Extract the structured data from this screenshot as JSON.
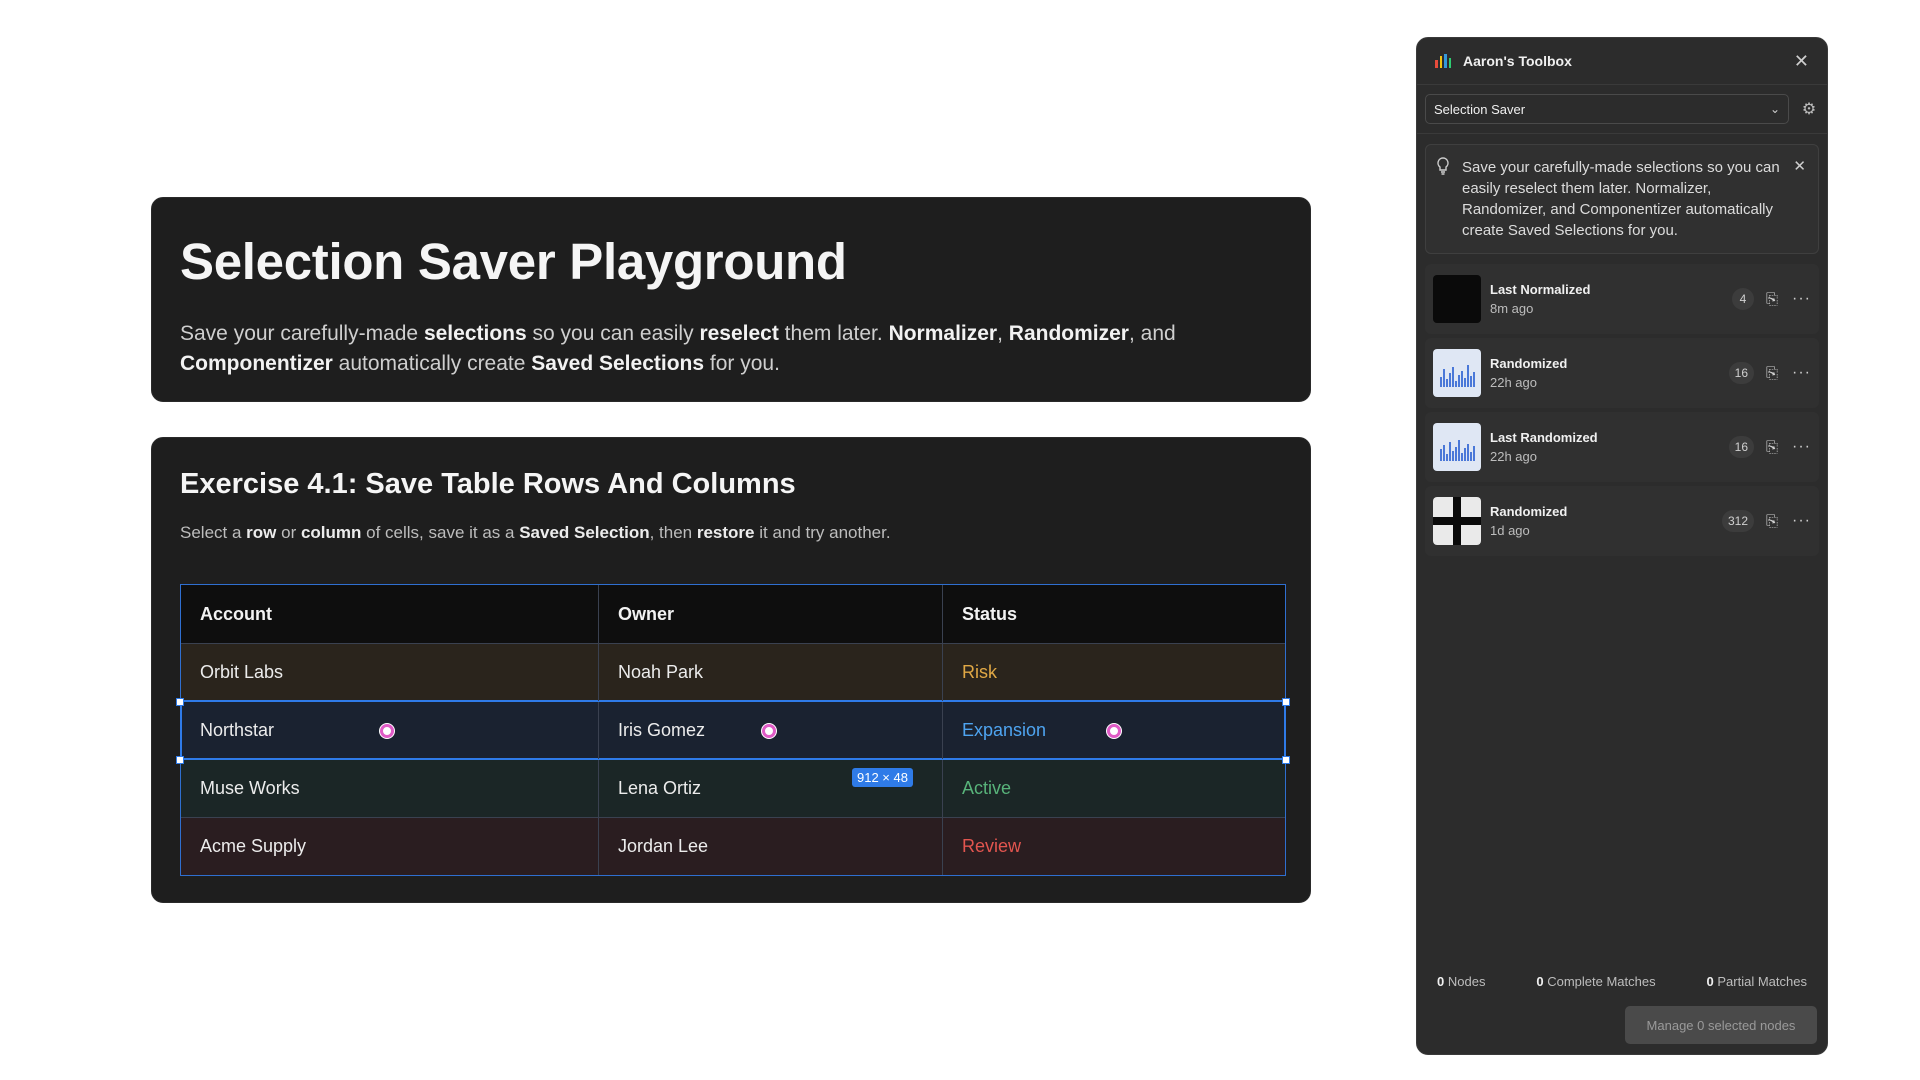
{
  "hero": {
    "title": "Selection Saver Playground",
    "desc_parts": [
      "Save your carefully-made ",
      "selections",
      " so you can easily ",
      "reselect",
      " them later. ",
      "Normalizer",
      ", ",
      "Randomizer",
      ", and ",
      "Componentizer",
      " automatically create ",
      "Saved Selections",
      " for you."
    ]
  },
  "exercise": {
    "title": "Exercise 4.1: Save Table Rows And Columns",
    "desc_parts": [
      "Select a ",
      "row",
      " or ",
      "column",
      " of cells, save it as a ",
      "Saved Selection",
      ", then ",
      "restore",
      " it and try another."
    ],
    "table": {
      "headers": [
        "Account",
        "Owner",
        "Status"
      ],
      "rows": [
        [
          "Orbit Labs",
          "Noah Park",
          "Risk"
        ],
        [
          "Northstar",
          "Iris Gomez",
          "Expansion"
        ],
        [
          "Muse Works",
          "Lena Ortiz",
          "Active"
        ],
        [
          "Acme Supply",
          "Jordan Lee",
          "Review"
        ]
      ],
      "selection_size": "912 × 48"
    }
  },
  "panel": {
    "title": "Aaron's Toolbox",
    "tool_select": "Selection Saver",
    "tip": "Save your carefully-made selections so you can easily reselect them later. Normalizer, Randomizer, and Componentizer automatically create Saved Selections for you.",
    "items": [
      {
        "name": "Last Normalized",
        "time": "8m ago",
        "count": "4",
        "thumb": "dark"
      },
      {
        "name": "Randomized",
        "time": "22h ago",
        "count": "16",
        "thumb": "bars"
      },
      {
        "name": "Last Randomized",
        "time": "22h ago",
        "count": "16",
        "thumb": "bars"
      },
      {
        "name": "Randomized",
        "time": "1d ago",
        "count": "312",
        "thumb": "cross"
      }
    ],
    "stats": {
      "nodes_count": "0",
      "nodes_label": "Nodes",
      "complete_count": "0",
      "complete_label": "Complete Matches",
      "partial_count": "0",
      "partial_label": "Partial Matches"
    },
    "manage_label": "Manage 0 selected nodes"
  },
  "colors": {
    "accent": "#2f7be8",
    "risk": "#e0a845",
    "expansion": "#4ea4f0",
    "active": "#58b37a",
    "review": "#e2554f",
    "pin": "#e05bc6"
  },
  "icons": [
    "toolbox-logo-icon",
    "close-icon",
    "chevron-down-icon",
    "gear-icon",
    "lightbulb-icon",
    "restore-icon",
    "more-icon",
    "selection-pin-icon"
  ]
}
